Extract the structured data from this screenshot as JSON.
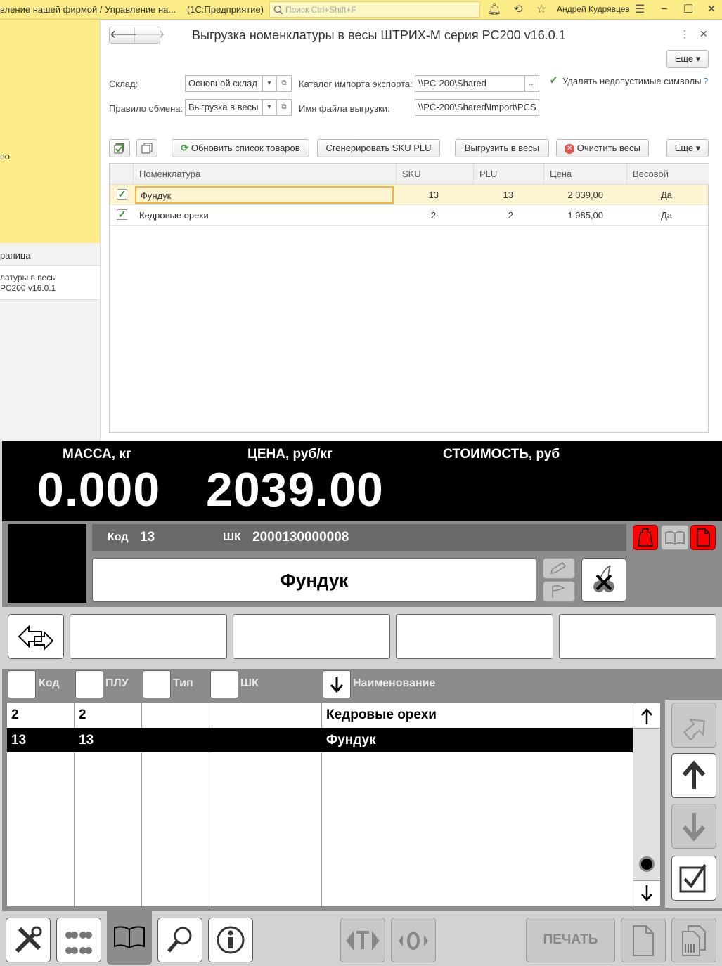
{
  "titlebar": {
    "title": "вление нашей фирмой / Управление на...",
    "app": "(1С:Предприятие)",
    "search_placeholder": "Поиск Ctrl+Shift+F",
    "user": "Андрей Кудрявцев"
  },
  "left_panel": {
    "partial_item": "во",
    "section_title": "раница",
    "item_line1": "латуры в весы",
    "item_line2": "РС200 v16.0.1"
  },
  "form": {
    "title": "Выгрузка номенклатуры в весы ШТРИХ-М серия PC200 v16.0.1",
    "more_label": "Еще",
    "warehouse_label": "Склад:",
    "warehouse_value": "Основной склад",
    "exchange_rule_label": "Правило обмена:",
    "exchange_rule_value": "Выгрузка в весы",
    "catalog_label": "Каталог импорта экспорта:",
    "catalog_value": "\\\\PC-200\\Shared",
    "filename_label": "Имя файла выгрузки:",
    "filename_value": "\\\\PC-200\\Shared\\Import\\PCS",
    "remove_invalid_label": "Удалять недопустимые символы",
    "help": "?",
    "buttons": {
      "refresh": "Обновить список товаров",
      "generate": "Сгенерировать SKU PLU",
      "upload": "Выгрузить в весы",
      "clear": "Очистить весы",
      "more": "Еще"
    },
    "table": {
      "headers": [
        "Номенклатура",
        "SKU",
        "PLU",
        "Цена",
        "Весовой"
      ],
      "rows": [
        {
          "name": "Фундук",
          "sku": "13",
          "plu": "13",
          "price": "2 039,00",
          "weight": "Да"
        },
        {
          "name": "Кедровые орехи",
          "sku": "2",
          "plu": "2",
          "price": "1 985,00",
          "weight": "Да"
        }
      ]
    }
  },
  "scale": {
    "mass_label": "МАССА, кг",
    "mass_value": "0.000",
    "price_label": "ЦЕНА, руб/кг",
    "price_value": "2039.00",
    "cost_label": "СТОИМОСТЬ, руб",
    "code_label": "Код",
    "code_value": "13",
    "barcode_label": "ШК",
    "barcode_value": "2000130000008",
    "product_name": "Фундук",
    "list_headers": {
      "code": "Код",
      "plu": "ПЛУ",
      "type": "Тип",
      "barcode": "ШК",
      "name": "Наименование"
    },
    "list_rows": [
      {
        "code": "2",
        "plu": "2",
        "name": "Кедровые орехи",
        "selected": false
      },
      {
        "code": "13",
        "plu": "13",
        "name": "Фундук",
        "selected": true
      }
    ],
    "print_label": "ПЕЧАТЬ"
  }
}
